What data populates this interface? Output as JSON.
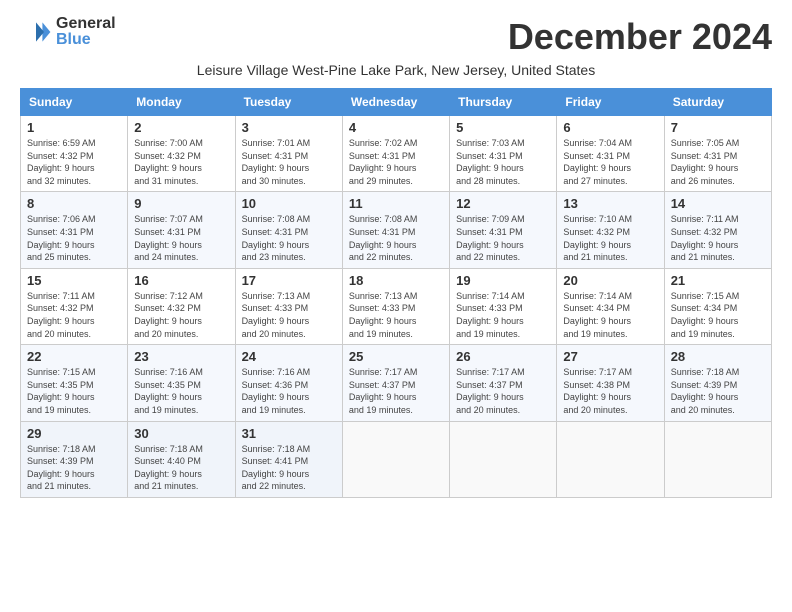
{
  "header": {
    "logo_general": "General",
    "logo_blue": "Blue",
    "month_title": "December 2024"
  },
  "subtitle": "Leisure Village West-Pine Lake Park, New Jersey, United States",
  "days_of_week": [
    "Sunday",
    "Monday",
    "Tuesday",
    "Wednesday",
    "Thursday",
    "Friday",
    "Saturday"
  ],
  "weeks": [
    [
      {
        "day": "1",
        "info": "Sunrise: 6:59 AM\nSunset: 4:32 PM\nDaylight: 9 hours\nand 32 minutes."
      },
      {
        "day": "2",
        "info": "Sunrise: 7:00 AM\nSunset: 4:32 PM\nDaylight: 9 hours\nand 31 minutes."
      },
      {
        "day": "3",
        "info": "Sunrise: 7:01 AM\nSunset: 4:31 PM\nDaylight: 9 hours\nand 30 minutes."
      },
      {
        "day": "4",
        "info": "Sunrise: 7:02 AM\nSunset: 4:31 PM\nDaylight: 9 hours\nand 29 minutes."
      },
      {
        "day": "5",
        "info": "Sunrise: 7:03 AM\nSunset: 4:31 PM\nDaylight: 9 hours\nand 28 minutes."
      },
      {
        "day": "6",
        "info": "Sunrise: 7:04 AM\nSunset: 4:31 PM\nDaylight: 9 hours\nand 27 minutes."
      },
      {
        "day": "7",
        "info": "Sunrise: 7:05 AM\nSunset: 4:31 PM\nDaylight: 9 hours\nand 26 minutes."
      }
    ],
    [
      {
        "day": "8",
        "info": "Sunrise: 7:06 AM\nSunset: 4:31 PM\nDaylight: 9 hours\nand 25 minutes."
      },
      {
        "day": "9",
        "info": "Sunrise: 7:07 AM\nSunset: 4:31 PM\nDaylight: 9 hours\nand 24 minutes."
      },
      {
        "day": "10",
        "info": "Sunrise: 7:08 AM\nSunset: 4:31 PM\nDaylight: 9 hours\nand 23 minutes."
      },
      {
        "day": "11",
        "info": "Sunrise: 7:08 AM\nSunset: 4:31 PM\nDaylight: 9 hours\nand 22 minutes."
      },
      {
        "day": "12",
        "info": "Sunrise: 7:09 AM\nSunset: 4:31 PM\nDaylight: 9 hours\nand 22 minutes."
      },
      {
        "day": "13",
        "info": "Sunrise: 7:10 AM\nSunset: 4:32 PM\nDaylight: 9 hours\nand 21 minutes."
      },
      {
        "day": "14",
        "info": "Sunrise: 7:11 AM\nSunset: 4:32 PM\nDaylight: 9 hours\nand 21 minutes."
      }
    ],
    [
      {
        "day": "15",
        "info": "Sunrise: 7:11 AM\nSunset: 4:32 PM\nDaylight: 9 hours\nand 20 minutes."
      },
      {
        "day": "16",
        "info": "Sunrise: 7:12 AM\nSunset: 4:32 PM\nDaylight: 9 hours\nand 20 minutes."
      },
      {
        "day": "17",
        "info": "Sunrise: 7:13 AM\nSunset: 4:33 PM\nDaylight: 9 hours\nand 20 minutes."
      },
      {
        "day": "18",
        "info": "Sunrise: 7:13 AM\nSunset: 4:33 PM\nDaylight: 9 hours\nand 19 minutes."
      },
      {
        "day": "19",
        "info": "Sunrise: 7:14 AM\nSunset: 4:33 PM\nDaylight: 9 hours\nand 19 minutes."
      },
      {
        "day": "20",
        "info": "Sunrise: 7:14 AM\nSunset: 4:34 PM\nDaylight: 9 hours\nand 19 minutes."
      },
      {
        "day": "21",
        "info": "Sunrise: 7:15 AM\nSunset: 4:34 PM\nDaylight: 9 hours\nand 19 minutes."
      }
    ],
    [
      {
        "day": "22",
        "info": "Sunrise: 7:15 AM\nSunset: 4:35 PM\nDaylight: 9 hours\nand 19 minutes."
      },
      {
        "day": "23",
        "info": "Sunrise: 7:16 AM\nSunset: 4:35 PM\nDaylight: 9 hours\nand 19 minutes."
      },
      {
        "day": "24",
        "info": "Sunrise: 7:16 AM\nSunset: 4:36 PM\nDaylight: 9 hours\nand 19 minutes."
      },
      {
        "day": "25",
        "info": "Sunrise: 7:17 AM\nSunset: 4:37 PM\nDaylight: 9 hours\nand 19 minutes."
      },
      {
        "day": "26",
        "info": "Sunrise: 7:17 AM\nSunset: 4:37 PM\nDaylight: 9 hours\nand 20 minutes."
      },
      {
        "day": "27",
        "info": "Sunrise: 7:17 AM\nSunset: 4:38 PM\nDaylight: 9 hours\nand 20 minutes."
      },
      {
        "day": "28",
        "info": "Sunrise: 7:18 AM\nSunset: 4:39 PM\nDaylight: 9 hours\nand 20 minutes."
      }
    ],
    [
      {
        "day": "29",
        "info": "Sunrise: 7:18 AM\nSunset: 4:39 PM\nDaylight: 9 hours\nand 21 minutes."
      },
      {
        "day": "30",
        "info": "Sunrise: 7:18 AM\nSunset: 4:40 PM\nDaylight: 9 hours\nand 21 minutes."
      },
      {
        "day": "31",
        "info": "Sunrise: 7:18 AM\nSunset: 4:41 PM\nDaylight: 9 hours\nand 22 minutes."
      },
      {
        "day": "",
        "info": ""
      },
      {
        "day": "",
        "info": ""
      },
      {
        "day": "",
        "info": ""
      },
      {
        "day": "",
        "info": ""
      }
    ]
  ]
}
